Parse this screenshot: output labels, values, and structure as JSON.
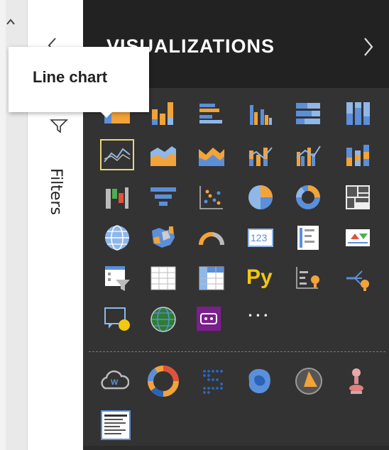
{
  "panel": {
    "title": "VISUALIZATIONS",
    "filters_label": "Filters",
    "tooltip": "Line chart"
  },
  "icons": {
    "row1": [
      "stacked-bar-chart-icon",
      "stacked-column-chart-icon",
      "clustered-bar-chart-icon",
      "clustered-column-chart-icon",
      "100pct-stacked-bar-chart-icon",
      "100pct-stacked-column-chart-icon"
    ],
    "row2": [
      "line-chart-icon",
      "area-chart-icon",
      "stacked-area-chart-icon",
      "line-and-stacked-column-chart-icon",
      "line-and-clustered-column-chart-icon",
      "ribbon-chart-icon"
    ],
    "row3": [
      "waterfall-chart-icon",
      "funnel-chart-icon",
      "scatter-chart-icon",
      "pie-chart-icon",
      "donut-chart-icon",
      "treemap-icon"
    ],
    "row4": [
      "map-icon",
      "filled-map-icon",
      "gauge-icon",
      "card-icon",
      "multi-row-card-icon",
      "kpi-icon"
    ],
    "row5": [
      "slicer-icon",
      "table-icon",
      "matrix-icon",
      "python-visual-icon",
      "key-influencers-icon",
      "decomposition-tree-icon"
    ],
    "row6": [
      "qa-icon",
      "globe-map-icon",
      "powerapps-icon",
      "more-visuals-icon"
    ],
    "custom": [
      "word-cloud-icon",
      "sunburst-icon",
      "dot-plot-icon",
      "blob-map-icon",
      "radar-chart-icon",
      "pin-icon",
      "text-table-icon"
    ]
  },
  "python_label": "Py",
  "card_label": "123",
  "more_label": "• • •",
  "word_cloud_label": "W",
  "colors": {
    "panel_bg": "#333333",
    "header_bg": "#222222",
    "orange": "#f2a33a",
    "blue": "#5b8fd9",
    "light_blue": "#8fb7e8",
    "yellow": "#f2c811",
    "selected_border": "#e8d77a",
    "purple": "#7a1f8c"
  }
}
